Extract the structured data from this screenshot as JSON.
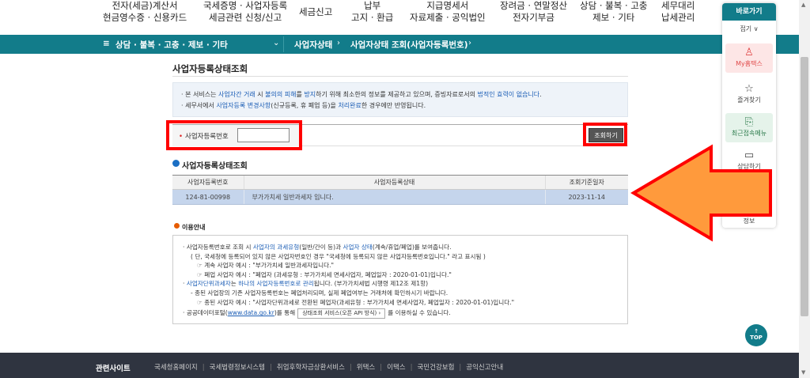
{
  "top_nav": [
    {
      "line1": "전자(세금)계산서",
      "line2": "현금영수증 · 신용카드"
    },
    {
      "line1": "국세증명 · 사업자등록",
      "line2": "세금관련 신청/신고"
    },
    {
      "line1": "세금신고",
      "line2": ""
    },
    {
      "line1": "납부",
      "line2": "고지 · 환급"
    },
    {
      "line1": "지급명세서",
      "line2": "자료제출 · 공익법인"
    },
    {
      "line1": "장려금 · 연말정산",
      "line2": "전자기부금"
    },
    {
      "line1": "상담 · 불복 · 고충",
      "line2": "제보 · 기타"
    },
    {
      "line1": "세무대리",
      "line2": "납세관리"
    }
  ],
  "breadcrumb": {
    "menu_icon": "≡",
    "section": "상담 · 불복 · 고충 · 제보 · 기타",
    "level2": "사업자상태",
    "level3": "사업자상태 조회(사업자등록번호)"
  },
  "page_title": "사업자등록상태조회",
  "notice": {
    "l1_a": "· 본 서비스는 ",
    "l1_b": "사업자간 거래",
    "l1_c": " 시 ",
    "l1_d": "불의의 피해",
    "l1_e": "를 ",
    "l1_f": "방지",
    "l1_g": "하기 위해 최소한의 정보를 제공하고 있으며, 증빙자료로서의 ",
    "l1_h": "법적인 효력이 없습니다",
    "l1_i": ".",
    "l2_a": "· 세무서에서 ",
    "l2_b": "사업자등록 변경사항",
    "l2_c": "(신규등록, 휴 폐업 등)을 ",
    "l2_d": "처리완료",
    "l2_e": "한 경우에만 반영됩니다."
  },
  "search": {
    "label_dot": "•",
    "label": "사업자등록번호",
    "input_value": "",
    "button": "조회하기"
  },
  "results": {
    "title": "사업자등록상태조회",
    "headers": [
      "사업자등록번호",
      "사업자등록상태",
      "조회기준일자"
    ],
    "rows": [
      [
        "124-81-00998",
        "부가가치세 일반과세자 입니다.",
        "2023-11-14"
      ]
    ]
  },
  "guide": {
    "title": "이용안내",
    "lines": {
      "a1": "· 사업자등록번호로 조회 시 ",
      "a2": "사업자의 과세유형",
      "a3": "(일반/간이 등)과 ",
      "a4": "사업자 상태",
      "a5": "(계속/휴업/폐업)를 보여줍니다.",
      "b": "( 단, 국세청에 등록되어 있지 않은 사업자번호인 경우 \"국세청에 등록되지 않은 사업자등록번호입니다.\" 라고 표시됨 )",
      "c": "☞ 계속 사업자 예시 : \"부가가치세 일반과세자입니다.\"",
      "d": "☞ 폐업 사업자 예시 : \"폐업자 (과세유형 : 부가가치세 면세사업자, 폐업일자 : 2020-01-01)입니다.\"",
      "e1": "· ",
      "e2": "사업자단위과세자",
      "e3": "는 ",
      "e4": "하나의 사업자등록번호로 관리",
      "e5": "됩니다. (부가가치세법 시행령 제12조 제1항)",
      "f": "- 종된 사업장의 기존 사업자등록번호는 폐업처리되며, 실제 폐업여부는 거래처에 확인하시기 바랍니다.",
      "g": "☞ 종된 사업자 예시 : \"사업자단위과세로 전환된 폐업자(과세유형 : 부가가치세 면세사업자, 폐업일자 : 2020-01-01)입니다.\"",
      "h1": "· 공공데이터포털(",
      "h2": "www.data.go.kr",
      "h3": ")를 통해",
      "h_btn": "상태조회 서비스(오픈 API 방식)  ›",
      "h4": "를 이용하실 수 있습니다."
    }
  },
  "footer": {
    "title": "관련사이트",
    "links": [
      "국세청홈페이지",
      "국세법령정보시스템",
      "취업후학자금상환서비스",
      "위택스",
      "이택스",
      "국민건강보험",
      "공익신고안내"
    ]
  },
  "quick": {
    "title": "바로가기",
    "fold": "접기 ∨",
    "items": {
      "mytax": "My홈택스",
      "fav": "즐겨찾기",
      "recent": "최근접속메뉴",
      "consult": "상담하기",
      "hidden": "정보"
    },
    "icons": {
      "mytax": "person-icon",
      "fav": "star-icon",
      "recent": "doc-search-icon",
      "consult": "monitor-icon"
    }
  },
  "top_button": {
    "arrow": "↑",
    "label": "TOP"
  },
  "colors": {
    "teal": "#127c8a",
    "highlight_red": "#ff0000",
    "arrow_orange": "#ff9a3c",
    "row_highlight": "#c5d5ec"
  }
}
